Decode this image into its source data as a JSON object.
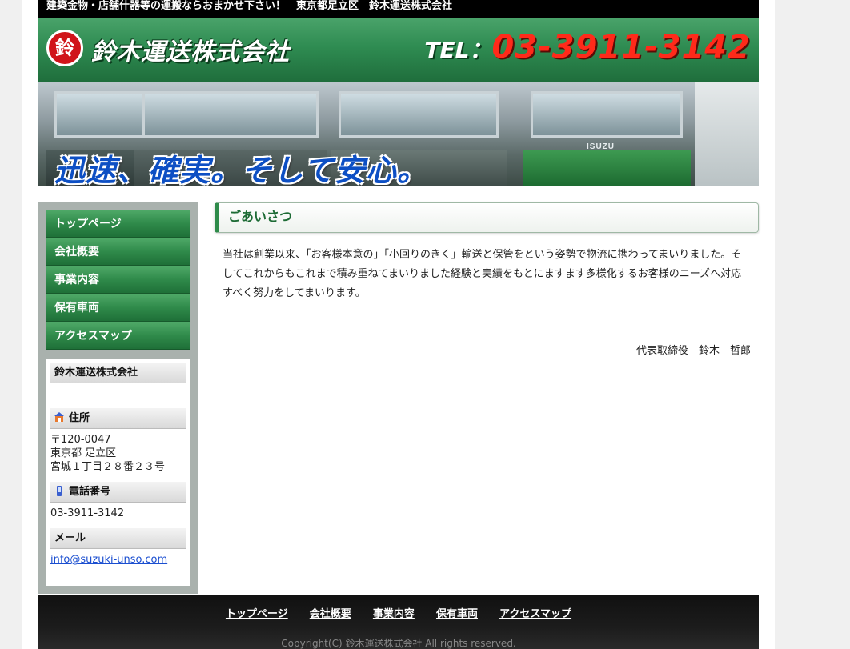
{
  "topbar": {
    "text": "建築金物・店舗什器等の運搬ならおまかせ下さい！　東京都足立区　鈴木運送株式会社"
  },
  "header": {
    "logo_char": "鈴",
    "company_name": "鈴木運送株式会社",
    "tel_label": "TEL：",
    "tel_number": "03-3911-3142"
  },
  "hero": {
    "slogan": "迅速、確実。そして安心。",
    "truck_badge": "ISUZU"
  },
  "nav": {
    "items": [
      {
        "label": "トップページ"
      },
      {
        "label": "会社概要"
      },
      {
        "label": "事業内容"
      },
      {
        "label": "保有車両"
      },
      {
        "label": "アクセスマップ"
      }
    ]
  },
  "info": {
    "company": "鈴木運送株式会社",
    "address_heading": "住所",
    "postal": "〒120-0047",
    "address_line1": "東京都 足立区",
    "address_line2": "宮城１丁目２８番２３号",
    "phone_heading": "電話番号",
    "phone": "03-3911-3142",
    "mail_heading": "メール",
    "email": "info@suzuki-unso.com"
  },
  "main": {
    "heading": "ごあいさつ",
    "body": "当社は創業以来、「お客様本意の」「小回りのきく」輸送と保管をという姿勢で物流に携わってまいりました。そしてこれからもこれまで積み重ねてまいりました経験と実績をもとにますます多様化するお客様のニーズへ対応すべく努力をしてまいります。",
    "signature": "代表取締役　鈴木　哲郎"
  },
  "footer": {
    "links": [
      {
        "label": "トップページ"
      },
      {
        "label": "会社概要"
      },
      {
        "label": "事業内容"
      },
      {
        "label": "保有車両"
      },
      {
        "label": "アクセスマップ"
      }
    ],
    "copyright": "Copyright(C) 鈴木運送株式会社 All rights reserved."
  },
  "colors": {
    "brand_green": "#2f8c52",
    "tel_red": "#ff2a1a",
    "slogan_blue": "#0d4fc4"
  }
}
